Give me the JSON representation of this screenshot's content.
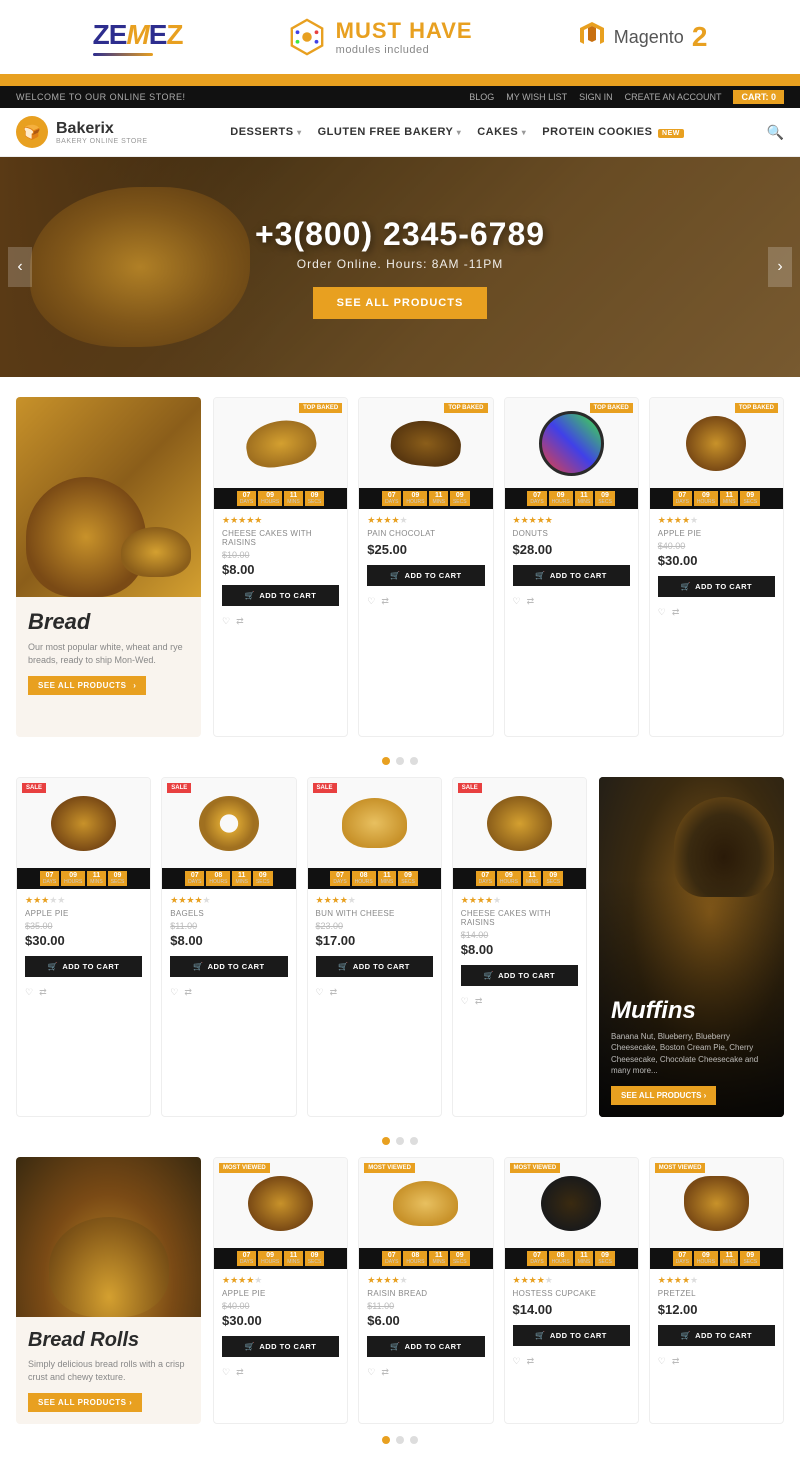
{
  "badges": {
    "zemes": "ZemeZ",
    "must_have_line1": "MUST HAVE",
    "must_have_line2": "modules included",
    "magento_label": "Magento",
    "magento_version": "2"
  },
  "topbar": {
    "welcome": "WELCOME TO OUR ONLINE STORE!",
    "links": [
      "BLOG",
      "MY WISH LIST",
      "SIGN IN",
      "CREATE AN ACCOUNT"
    ],
    "cart": "CART: 0"
  },
  "nav": {
    "logo": "Bakerix",
    "logo_sub": "BAKERY ONLINE STORE",
    "links": [
      "DESSERTS",
      "GLUTEN FREE BAKERY",
      "CAKES",
      "PROTEIN COOKIES"
    ],
    "protein_badge": "NEW"
  },
  "hero": {
    "phone": "+3(800) 2345-6789",
    "subtitle": "Order Online. Hours: 8AM -11PM",
    "cta": "SEE ALL PRODUCTS"
  },
  "featured_bread": {
    "title": "Bread",
    "description": "Our most popular white, wheat and rye breads, ready to ship Mon-Wed.",
    "cta": "SEE ALL PRODUCTS"
  },
  "row1_products": [
    {
      "name": "CHEESE CAKES WITH RAISINS",
      "price": "$8.00",
      "old_price": "$10.00",
      "badge": "TOP BAKED",
      "timer": [
        "07",
        "09",
        "11",
        "09"
      ],
      "timer_labels": [
        "DAYS",
        "HOURS",
        "MINS",
        "SECS"
      ],
      "stars": 5,
      "visual": "food-croissant"
    },
    {
      "name": "PAIN CHOCOLAT",
      "price": "$25.00",
      "badge": "TOP BAKED",
      "timer": [
        "07",
        "09",
        "11",
        "09"
      ],
      "timer_labels": [
        "DAYS",
        "HOURS",
        "MINS",
        "SECS"
      ],
      "stars": 4,
      "visual": "food-croissant"
    },
    {
      "name": "DONUTS",
      "price": "$28.00",
      "badge": "TOP BAKED",
      "timer": [
        "07",
        "09",
        "11",
        "09"
      ],
      "timer_labels": [
        "DAYS",
        "HOURS",
        "MINS",
        "SECS"
      ],
      "stars": 5,
      "visual": "food-donut"
    },
    {
      "name": "APPLE PIE",
      "price": "$30.00",
      "old_price": "$40.00",
      "badge": "TOP BAKED",
      "timer": [
        "07",
        "09",
        "11",
        "09"
      ],
      "timer_labels": [
        "DAYS",
        "HOURS",
        "MINS",
        "SECS"
      ],
      "stars": 4,
      "visual": "food-cookie"
    }
  ],
  "row2_products": [
    {
      "name": "APPLE PIE",
      "price": "$30.00",
      "old_price": "$35.00",
      "badge": "SALE",
      "timer": [
        "07",
        "09",
        "11",
        "09"
      ],
      "timer_labels": [
        "DAYS",
        "HOURS",
        "MINS",
        "SECS"
      ],
      "stars": 3,
      "visual": "food-pie"
    },
    {
      "name": "BAGELS",
      "price": "$8.00",
      "old_price": "$11.00",
      "badge": "SALE",
      "timer": [
        "07",
        "08",
        "11",
        "09"
      ],
      "timer_labels": [
        "DAYS",
        "HOURS",
        "MINS",
        "SECS"
      ],
      "stars": 4,
      "visual": "food-bagel"
    },
    {
      "name": "BUN WITH CHEESE",
      "price": "$17.00",
      "old_price": "$23.00",
      "badge": "SALE",
      "timer": [
        "07",
        "08",
        "11",
        "09"
      ],
      "timer_labels": [
        "DAYS",
        "HOURS",
        "MINS",
        "SECS"
      ],
      "stars": 4,
      "visual": "food-bun"
    },
    {
      "name": "CHEESE CAKES WITH RAISINS",
      "price": "$8.00",
      "old_price": "$14.00",
      "badge": "SALE",
      "timer": [
        "07",
        "09",
        "11",
        "09"
      ],
      "timer_labels": [
        "DAYS",
        "HOURS",
        "MINS",
        "SECS"
      ],
      "stars": 4,
      "visual": "food-rolls"
    }
  ],
  "muffins": {
    "title": "Muffins",
    "description": "Banana Nut, Blueberry, Blueberry Cheesecake, Boston Cream Pie, Cherry Cheesecake, Chocolate Cheesecake and many more...",
    "cta": "SEE ALL PRODUCTS"
  },
  "bread_rolls": {
    "title": "Bread Rolls",
    "description": "Simply delicious bread rolls with a crisp crust and chewy texture.",
    "cta": "SEE ALL PRODUCTS"
  },
  "row3_products": [
    {
      "name": "APPLE PIE",
      "price": "$30.00",
      "old_price": "$40.00",
      "badge": "MOST VIEWED",
      "timer": [
        "07",
        "09",
        "11",
        "09"
      ],
      "timer_labels": [
        "DAYS",
        "HOURS",
        "MINS",
        "SECS"
      ],
      "stars": 4,
      "visual": "food-pie"
    },
    {
      "name": "RAISIN BREAD",
      "price": "$6.00",
      "old_price": "$11.00",
      "badge": "MOST VIEWED",
      "timer": [
        "07",
        "08",
        "11",
        "09"
      ],
      "timer_labels": [
        "DAYS",
        "HOURS",
        "MINS",
        "SECS"
      ],
      "stars": 4,
      "visual": "food-raisin"
    },
    {
      "name": "HOSTESS CUPCAKE",
      "price": "$14.00",
      "badge": "MOST VIEWED",
      "timer": [
        "07",
        "08",
        "11",
        "09"
      ],
      "timer_labels": [
        "DAYS",
        "HOURS",
        "MINS",
        "SECS"
      ],
      "stars": 4,
      "visual": "food-hostess"
    },
    {
      "name": "PRETZEL",
      "price": "$12.00",
      "badge": "MOST VIEWED",
      "timer": [
        "07",
        "09",
        "11",
        "09"
      ],
      "timer_labels": [
        "DAYS",
        "HOURS",
        "MINS",
        "SECS"
      ],
      "stars": 4,
      "visual": "food-pretzel"
    }
  ],
  "add_to_cart": "ADD TO CART"
}
